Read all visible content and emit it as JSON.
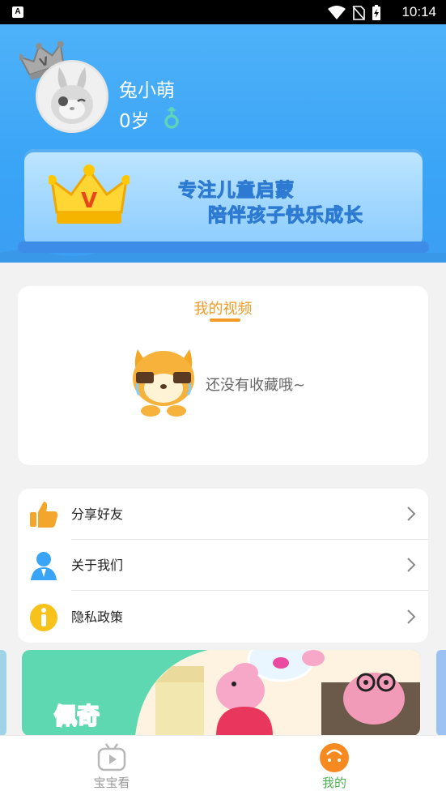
{
  "status_bar": {
    "time": "10:14",
    "app_badge": "A"
  },
  "profile": {
    "username": "兔小萌",
    "age": "0岁",
    "crown_badge": "V"
  },
  "vip_banner": {
    "badge": "V",
    "line1": "专注儿童启蒙",
    "line2": "陪伴孩子快乐成长"
  },
  "my_videos": {
    "title": "我的视频",
    "empty_text": "还没有收藏哦~"
  },
  "menu": [
    {
      "label": "分享好友",
      "icon": "thumbs-up-icon"
    },
    {
      "label": "关于我们",
      "icon": "person-icon"
    },
    {
      "label": "隐私政策",
      "icon": "info-icon"
    }
  ],
  "banner": {
    "text": "佩奇"
  },
  "tabbar": {
    "tabs": [
      {
        "label": "宝宝看",
        "active": false
      },
      {
        "label": "我的",
        "active": true
      }
    ],
    "active_color": "#4caf50",
    "inactive_color": "#999999"
  },
  "colors": {
    "header_blue": "#3aa4f6",
    "accent_orange": "#f29b26"
  }
}
